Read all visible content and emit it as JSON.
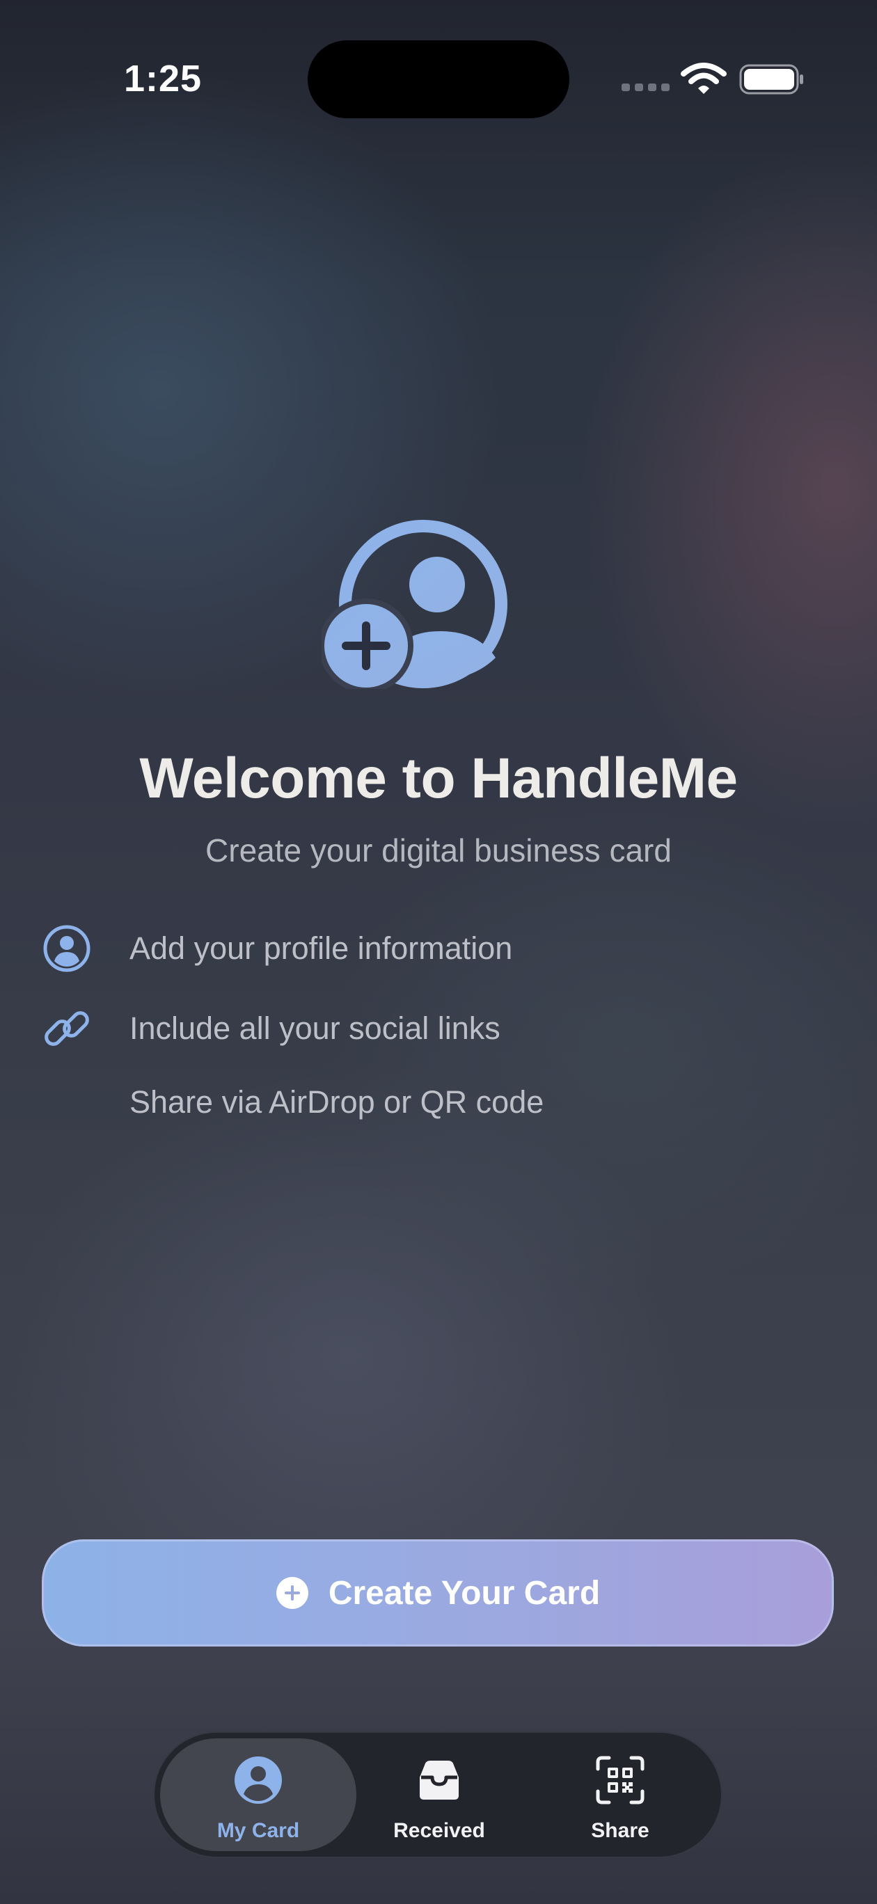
{
  "status_bar": {
    "time": "1:25"
  },
  "hero": {
    "title": "Welcome to HandleMe",
    "subtitle": "Create your digital business card"
  },
  "features": [
    {
      "icon": "person-circle-icon",
      "label": "Add your profile information"
    },
    {
      "icon": "link-icon",
      "label": "Include all your social links"
    },
    {
      "icon": "qr-code-icon",
      "label": "Share via AirDrop or QR code"
    }
  ],
  "create_button": {
    "label": "Create Your Card",
    "icon": "plus-circle-icon"
  },
  "tab_bar": {
    "tabs": [
      {
        "label": "My Card",
        "icon": "person-circle-fill-icon",
        "active": true
      },
      {
        "label": "Received",
        "icon": "tray-icon",
        "active": false
      },
      {
        "label": "Share",
        "icon": "qr-code-viewfinder-icon",
        "active": false
      }
    ]
  },
  "colors": {
    "accent": "#8EB3EA",
    "button_gradient_start": "#8DB2E8",
    "button_gradient_end": "#A89EDA",
    "tab_bar_background": "#23252C"
  }
}
